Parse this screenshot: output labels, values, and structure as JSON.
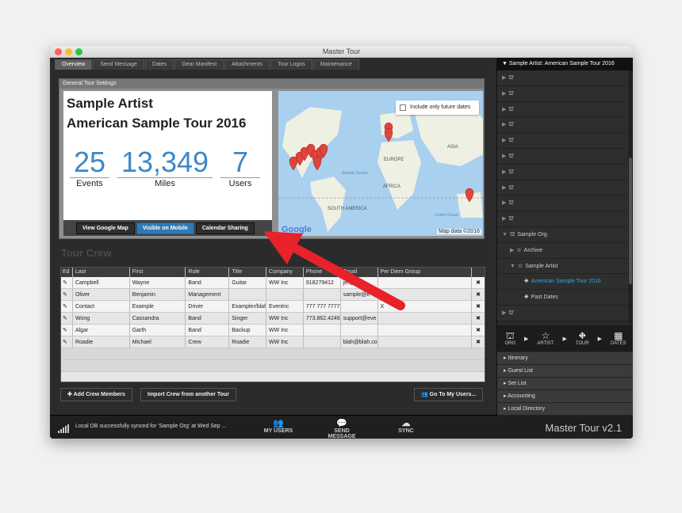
{
  "window": {
    "title": "Master Tour"
  },
  "tabs": [
    "Overview",
    "Send Message",
    "Dates",
    "Gear Manifest",
    "Attachments",
    "Tour Logos",
    "Maintenance"
  ],
  "settings": {
    "header": "General Tour Settings",
    "artist": "Sample Artist",
    "tour": "American Sample Tour 2016",
    "stats": [
      {
        "value": "25",
        "label": "Events"
      },
      {
        "value": "13,349",
        "label": "Miles"
      },
      {
        "value": "7",
        "label": "Users"
      }
    ],
    "buttons": {
      "map": "View Google Map",
      "mobile": "Visible on Mobile",
      "calendar": "Calendar Sharing"
    }
  },
  "map": {
    "future_label": "Include only future dates",
    "labels": [
      "ASIA",
      "EUROPE",
      "AFRICA",
      "SOUTH AMERICA",
      "Atlantic Ocean",
      "Indian Ocean"
    ],
    "data": "Map data ©2016",
    "logo": "Google"
  },
  "crew": {
    "title": "Tour Crew",
    "columns": [
      "Ed",
      "Last",
      "First",
      "Role",
      "Title",
      "Company",
      "Phone",
      "Email",
      "Per Diem Group"
    ],
    "rows": [
      [
        "Campbell",
        "Wayne",
        "Band",
        "Guitar",
        "WW Inc",
        "918279412",
        "jef@ever",
        ""
      ],
      [
        "Oliver",
        "Benjamin",
        "Management",
        "",
        "",
        "",
        "sample@e",
        ""
      ],
      [
        "Contact",
        "Example",
        "Driver",
        "Exampler/blah",
        "Eventric",
        "777 777 7777",
        "",
        "X"
      ],
      [
        "Wong",
        "Cassandra",
        "Band",
        "Singer",
        "WW Inc",
        "773.862.4246",
        "support@eve",
        ""
      ],
      [
        "Algar",
        "Garth",
        "Band",
        "Backup",
        "WW Inc",
        "",
        "",
        ""
      ],
      [
        "Roadie",
        "Michael",
        "Crew",
        "Roadie",
        "WW Inc",
        "",
        "blah@blah.com",
        ""
      ]
    ],
    "add_button": "Add Crew Members",
    "import_button": "Import Crew from another Tour",
    "goto_button": "Go To My Users..."
  },
  "status": {
    "message": "Local DB successfully synced for 'Sample Org' at Wed Sep ...",
    "my_users": "MY USERS",
    "send_message": "SEND MESSAGE",
    "sync": "SYNC",
    "version": "Master Tour v2.1"
  },
  "sidebar": {
    "header": "Sample Artist: American Sample Tour 2016",
    "org": "Sample Org",
    "archive": "Archive",
    "artist": "Sample Artist",
    "tour": "American Sample Tour 2016",
    "past": "Past Dates",
    "crumbs": [
      "ORG",
      "ARTIST",
      "TOUR",
      "DATES"
    ],
    "accordion": [
      "Itinerary",
      "Guest List",
      "Set List",
      "Accounting",
      "Local Directory"
    ]
  },
  "colors": {
    "accent": "#2f79b5",
    "link": "#2ea6e6",
    "number": "#3d87c7",
    "annotation_arrow": "#e8222a"
  }
}
